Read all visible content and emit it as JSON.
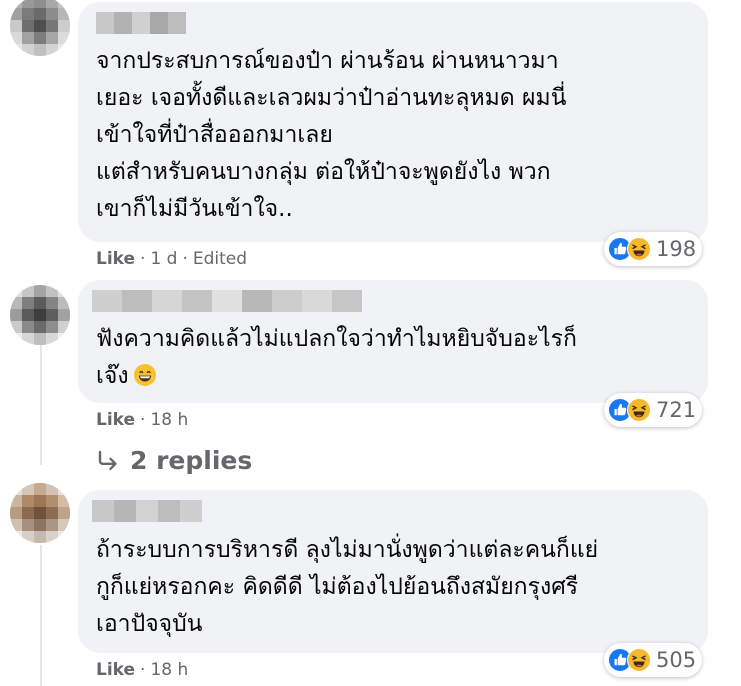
{
  "comments": [
    {
      "text": "จากประสบการณ์ของป๋า ผ่านร้อน ผ่านหนาวมา\nเยอะ เจอทั้งดีและเลวผมว่าป๋าอ่านทะลุหมด ผมนี่\nเข้าใจที่ป๋าสื่อออกมาเลย\nแต่สำหรับคนบางกลุ่ม ต่อให้ป๋าจะพูดยังไง พวก\nเขาก็ไม่มีวันเข้าใจ..",
      "like_label": "Like",
      "separator": "·",
      "time": "1 d",
      "edited": "Edited",
      "reaction_count": "198"
    },
    {
      "text": "ฟังความคิดแล้วไม่แปลกใจว่าทำไมหยิบจับอะไรก็\nเจ๊ง",
      "emoji": "😄",
      "like_label": "Like",
      "separator": "·",
      "time": "18 h",
      "reaction_count": "721",
      "replies_label": "2 replies"
    },
    {
      "text": "ถ้าระบบการบริหารดี ลุงไม่มานั่งพูดว่าแต่ละคนก็แย่\nกูก็แย่หรอกคะ คิดดีดี ไม่ต้องไปย้อนถึงสมัยกรุงศรี\nเอาปัจจุบัน",
      "like_label": "Like",
      "separator": "·",
      "time": "18 h",
      "reaction_count": "505"
    }
  ],
  "colors": {
    "bubble": "#f0f2f5",
    "meta_text": "#65676b",
    "like_blue": "#1877f2",
    "haha_yellow": "#f7b928"
  },
  "icons": {
    "like": "thumbs-up-icon",
    "haha": "haha-emoji-icon",
    "reply_arrow": "reply-arrow-icon"
  }
}
